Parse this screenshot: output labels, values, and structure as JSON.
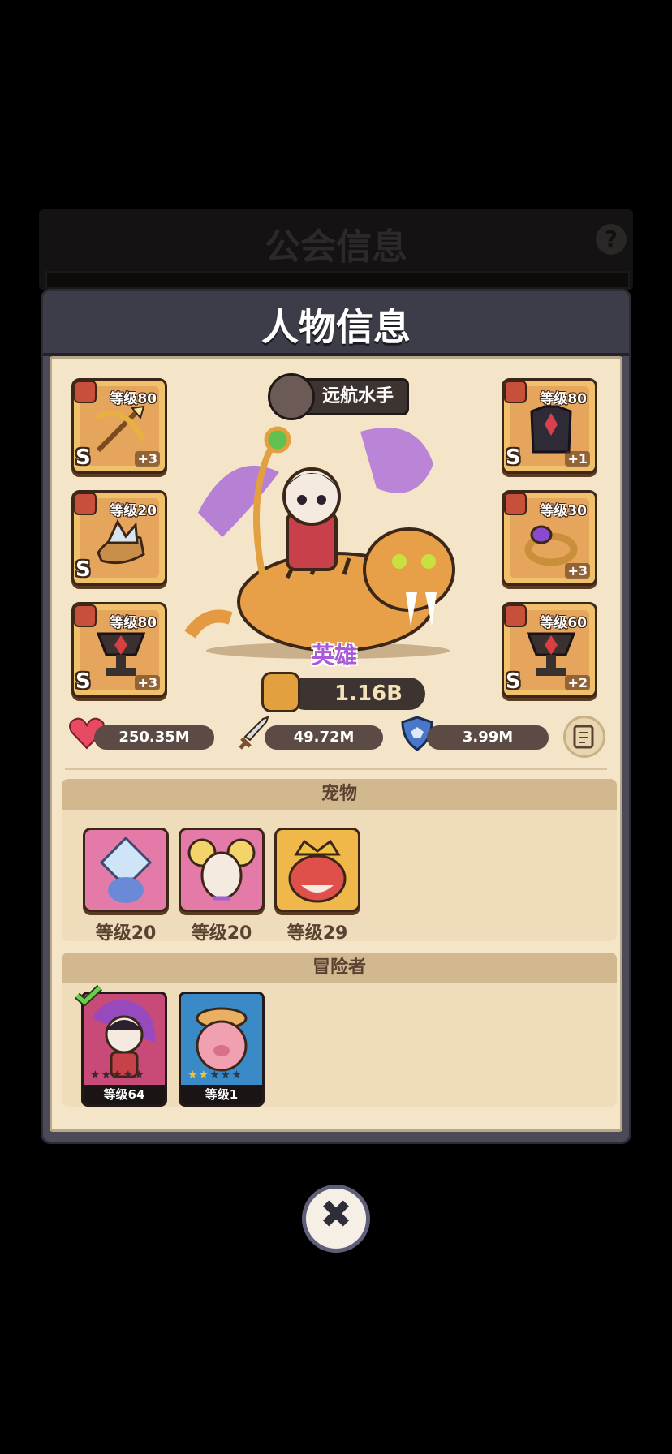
{
  "background_panel": {
    "title": "公会信息",
    "help_glyph": "?"
  },
  "dialog": {
    "title": "人物信息"
  },
  "hero": {
    "class_name": "远航水手",
    "rank": "英雄",
    "power": "1.16B"
  },
  "equipment_left": [
    {
      "level": "等级80",
      "grade": "S",
      "plus": "+3",
      "icon": "golden-bow-icon"
    },
    {
      "level": "等级20",
      "grade": "S",
      "plus": "",
      "icon": "crystal-gauntlet-icon"
    },
    {
      "level": "等级80",
      "grade": "S",
      "plus": "+3",
      "icon": "ruby-trophy-icon"
    }
  ],
  "equipment_right": [
    {
      "level": "等级80",
      "grade": "S",
      "plus": "+1",
      "icon": "dark-armor-icon"
    },
    {
      "level": "等级30",
      "grade": "",
      "plus": "+3",
      "icon": "gem-ring-icon"
    },
    {
      "level": "等级60",
      "grade": "S",
      "plus": "+2",
      "icon": "ruby-trophy-icon"
    }
  ],
  "stats": {
    "hp": "250.35M",
    "attack": "49.72M",
    "defense": "3.99M"
  },
  "pets": {
    "title": "宠物",
    "items": [
      {
        "level": "等级20",
        "icon": "ice-crystal-pet-icon"
      },
      {
        "level": "等级20",
        "icon": "mouse-pet-icon"
      },
      {
        "level": "等级29",
        "icon": "king-crab-pet-icon"
      }
    ]
  },
  "adventurers": {
    "title": "冒险者",
    "items": [
      {
        "level": "等级64",
        "stars": "★★★★★",
        "icon": "sailor-hero-icon"
      },
      {
        "level": "等级1",
        "stars": "★★★★★",
        "icon": "pig-adventurer-icon"
      }
    ]
  },
  "colors": {
    "accent": "#f0c06b",
    "panel": "#f5e5c8",
    "rank_purple": "#a85ad8"
  }
}
